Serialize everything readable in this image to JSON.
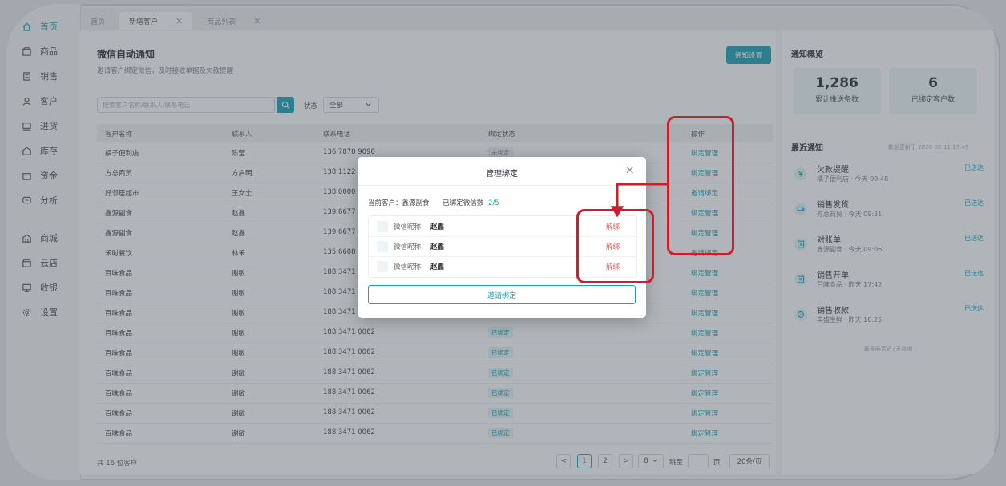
{
  "sidebar": {
    "items": [
      {
        "label": "首页",
        "icon": "home-icon"
      },
      {
        "label": "商品",
        "icon": "box-icon"
      },
      {
        "label": "销售",
        "icon": "receipt-icon"
      },
      {
        "label": "客户",
        "icon": "user-icon"
      },
      {
        "label": "进货",
        "icon": "truck-icon"
      },
      {
        "label": "库存",
        "icon": "warehouse-icon"
      },
      {
        "label": "资金",
        "icon": "wallet-icon"
      },
      {
        "label": "分析",
        "icon": "chart-icon"
      },
      {
        "label": "商城",
        "icon": "mall-icon"
      },
      {
        "label": "云店",
        "icon": "store-icon"
      },
      {
        "label": "收银",
        "icon": "cashier-icon"
      },
      {
        "label": "设置",
        "icon": "gear-icon"
      }
    ]
  },
  "tabs": [
    {
      "label": "首页"
    },
    {
      "label": "新增客户"
    },
    {
      "label": "商品列表"
    }
  ],
  "main": {
    "title": "微信自动通知",
    "subtitle": "邀请客户绑定微信，及时接收单据及欠款提醒",
    "settings_button": "通知设置",
    "search_placeholder": "搜索客户名称/联系人/联系电话",
    "status_label": "状态",
    "status_value": "全部",
    "columns": [
      "客户名称",
      "联系人",
      "联系电话",
      "绑定状态",
      "操作"
    ],
    "rows": [
      {
        "name": "橘子便利店",
        "contact": "陈莹",
        "phone": "136 7878 9090",
        "status": "未绑定",
        "op": "绑定管理"
      },
      {
        "name": "方总商贸",
        "contact": "方启明",
        "phone": "138 1122 5",
        "status": "",
        "op": "绑定管理"
      },
      {
        "name": "好邻居超市",
        "contact": "王女士",
        "phone": "138 0000 8",
        "status": "",
        "op": "邀请绑定"
      },
      {
        "name": "鑫源副食",
        "contact": "赵鑫",
        "phone": "139 6677 2",
        "status": "",
        "op": "绑定管理"
      },
      {
        "name": "鑫源副食",
        "contact": "赵鑫",
        "phone": "139 6677 2",
        "status": "",
        "op": "绑定管理"
      },
      {
        "name": "禾时餐饮",
        "contact": "林禾",
        "phone": "135 6608 9",
        "status": "",
        "op": "邀请绑定"
      },
      {
        "name": "百味食品",
        "contact": "谢敏",
        "phone": "188 3471 0",
        "status": "",
        "op": "绑定管理"
      },
      {
        "name": "百味食品",
        "contact": "谢敏",
        "phone": "188 3471 0",
        "status": "",
        "op": "绑定管理"
      },
      {
        "name": "百味食品",
        "contact": "谢敏",
        "phone": "188 3471 0",
        "status": "",
        "op": "绑定管理"
      },
      {
        "name": "百味食品",
        "contact": "谢敏",
        "phone": "188 3471 0062",
        "status": "已绑定",
        "op": "绑定管理"
      },
      {
        "name": "百味食品",
        "contact": "谢敏",
        "phone": "188 3471 0062",
        "status": "已绑定",
        "op": "绑定管理"
      },
      {
        "name": "百味食品",
        "contact": "谢敏",
        "phone": "188 3471 0062",
        "status": "已绑定",
        "op": "绑定管理"
      },
      {
        "name": "百味食品",
        "contact": "谢敏",
        "phone": "188 3471 0062",
        "status": "已绑定",
        "op": "绑定管理"
      },
      {
        "name": "百味食品",
        "contact": "谢敏",
        "phone": "188 3471 0062",
        "status": "已绑定",
        "op": "绑定管理"
      },
      {
        "name": "百味食品",
        "contact": "谢敏",
        "phone": "188 3471 0062",
        "status": "已绑定",
        "op": "绑定管理"
      }
    ],
    "footer_count": "共 16 位客户",
    "pagination": {
      "prev": "<",
      "page1": "1",
      "page2": "2",
      "next": ">",
      "page_size_select": "8",
      "jump_label": "跳至",
      "page_unit": "页",
      "per_page": "20条/页"
    }
  },
  "right": {
    "title": "通知概览",
    "stats": [
      {
        "value": "1,286",
        "label": "累计推送条数"
      },
      {
        "value": "6",
        "label": "已绑定客户数"
      }
    ],
    "recent_title": "最近通知",
    "updated": "数据更新于 2026-06-11 17:45",
    "notices": [
      {
        "title": "欠款提醒",
        "detail": "橘子便利店 · 今天 09:48",
        "status": "已送达",
        "icon": "yen-icon"
      },
      {
        "title": "销售发货",
        "detail": "方总商贸 · 今天 09:31",
        "status": "已送达",
        "icon": "truck-icon"
      },
      {
        "title": "对账单",
        "detail": "鑫源副食 · 今天 09:06",
        "status": "已送达",
        "icon": "statement-icon"
      },
      {
        "title": "销售开单",
        "detail": "百味食品 · 昨天 17:42",
        "status": "已送达",
        "icon": "doc-icon"
      },
      {
        "title": "销售收款",
        "detail": "丰盛生鲜 · 昨天 16:25",
        "status": "已送达",
        "icon": "coin-icon"
      }
    ],
    "footer": "最多展示近7天数据"
  },
  "modal": {
    "title": "管理绑定",
    "close": "×",
    "current_customer": "当前客户：鑫源副食",
    "bound_count_label": "已绑定微信数",
    "bound_count": "2/5",
    "wx_label": "微信昵称:",
    "bindings": [
      {
        "nickname": "赵鑫",
        "action": "解绑"
      },
      {
        "nickname": "赵鑫",
        "action": "解绑"
      },
      {
        "nickname": "赵鑫",
        "action": "解绑"
      }
    ],
    "invite_button": "邀请绑定"
  },
  "colors": {
    "accent": "#1aa3b5",
    "danger": "#e45656",
    "annotation": "#c9202c"
  }
}
